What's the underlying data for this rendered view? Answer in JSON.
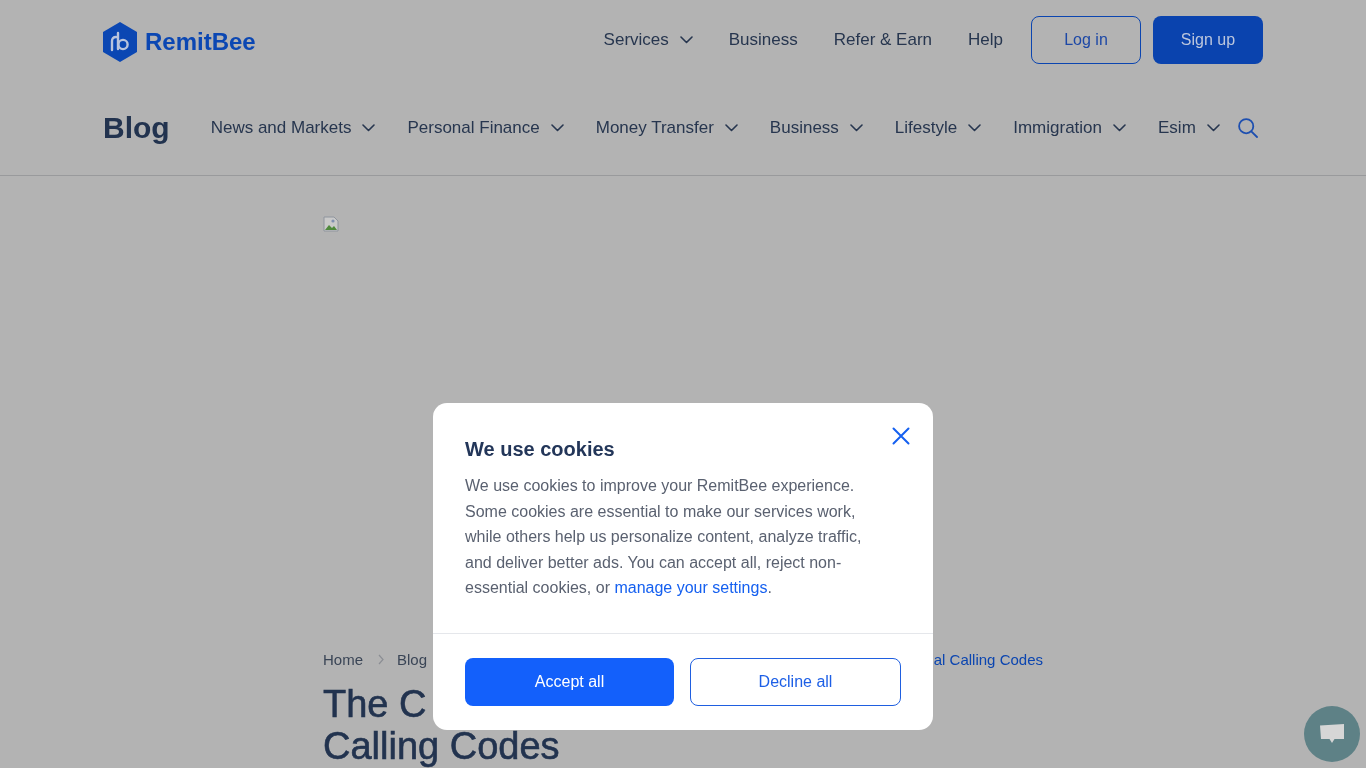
{
  "header": {
    "brand": "RemitBee",
    "nav": [
      {
        "label": "Services",
        "dropdown": true
      },
      {
        "label": "Business",
        "dropdown": false
      },
      {
        "label": "Refer & Earn",
        "dropdown": false
      },
      {
        "label": "Help",
        "dropdown": false
      }
    ],
    "buttons": [
      {
        "label": "Log in",
        "kind": "outline"
      },
      {
        "label": "Sign up",
        "kind": "filled"
      }
    ]
  },
  "blog_bar": {
    "title": "Blog",
    "categories": [
      "News and Markets",
      "Personal Finance",
      "Money Transfer",
      "Business",
      "Lifestyle",
      "Immigration",
      "Esim"
    ]
  },
  "article": {
    "breadcrumb": {
      "trail": [
        "Home",
        "Blog"
      ],
      "current": "al Calling Codes"
    },
    "title_lines": [
      "The C",
      "Calling Codes"
    ]
  },
  "cookie_dialog": {
    "title": "We use cookies",
    "text": "We use cookies to improve your RemitBee experience. Some cookies are essential to make our services work, while others help us personalize content, analyze traffic, and deliver better ads. You can accept all, reject non-essential cookies, or ",
    "link": "manage your settings",
    "text_end": ".",
    "buttons": [
      {
        "label": "Accept all",
        "kind": "primary"
      },
      {
        "label": "Decline all",
        "kind": "secondary"
      }
    ]
  }
}
